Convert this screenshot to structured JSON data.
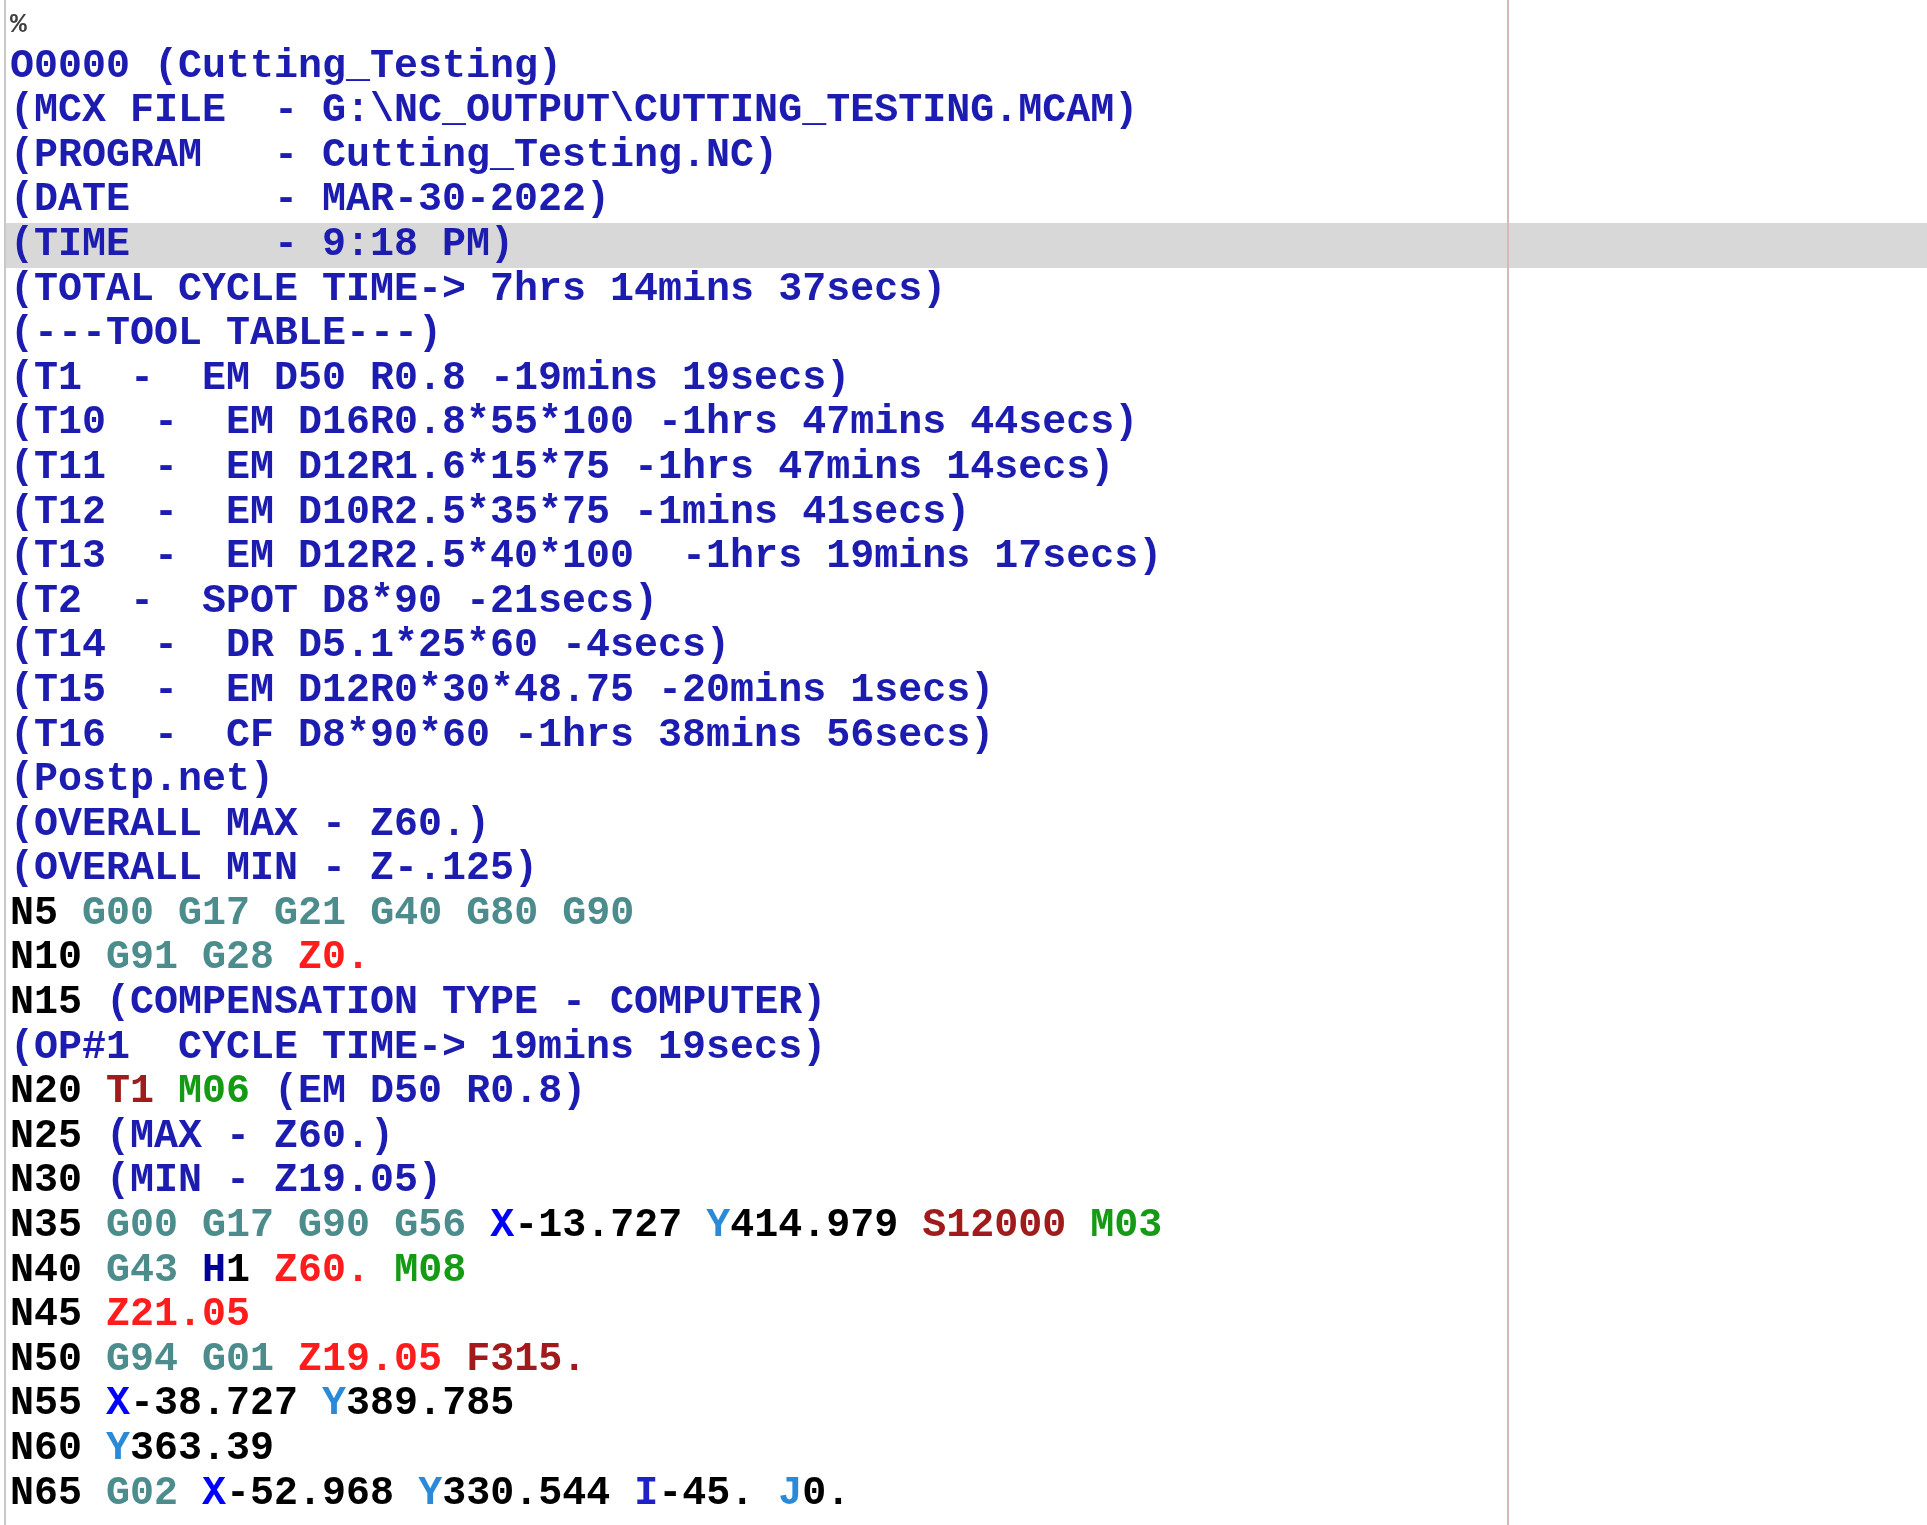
{
  "editor": {
    "lines": [
      {
        "selected": false,
        "tokens": [
          {
            "kind": "percent",
            "text": "%"
          }
        ]
      },
      {
        "selected": false,
        "tokens": [
          {
            "kind": "program",
            "text": "O0000"
          },
          {
            "kind": "comment",
            "text": "(Cutting_Testing)"
          }
        ]
      },
      {
        "selected": false,
        "tokens": [
          {
            "kind": "comment",
            "text": "(MCX FILE  - G:\\NC_OUTPUT\\CUTTING_TESTING.MCAM)"
          }
        ]
      },
      {
        "selected": false,
        "tokens": [
          {
            "kind": "comment",
            "text": "(PROGRAM   - Cutting_Testing.NC)"
          }
        ]
      },
      {
        "selected": false,
        "tokens": [
          {
            "kind": "comment",
            "text": "(DATE      - MAR-30-2022)"
          }
        ]
      },
      {
        "selected": true,
        "tokens": [
          {
            "kind": "comment",
            "text": "(TIME      - 9:18 PM)"
          }
        ]
      },
      {
        "selected": false,
        "tokens": [
          {
            "kind": "comment",
            "text": "(TOTAL CYCLE TIME-> 7hrs 14mins 37secs)"
          }
        ]
      },
      {
        "selected": false,
        "tokens": [
          {
            "kind": "comment",
            "text": "(---TOOL TABLE---)"
          }
        ]
      },
      {
        "selected": false,
        "tokens": [
          {
            "kind": "comment",
            "text": "(T1  -  EM D50 R0.8 -19mins 19secs)"
          }
        ]
      },
      {
        "selected": false,
        "tokens": [
          {
            "kind": "comment",
            "text": "(T10  -  EM D16R0.8*55*100 -1hrs 47mins 44secs)"
          }
        ]
      },
      {
        "selected": false,
        "tokens": [
          {
            "kind": "comment",
            "text": "(T11  -  EM D12R1.6*15*75 -1hrs 47mins 14secs)"
          }
        ]
      },
      {
        "selected": false,
        "tokens": [
          {
            "kind": "comment",
            "text": "(T12  -  EM D10R2.5*35*75 -1mins 41secs)"
          }
        ]
      },
      {
        "selected": false,
        "tokens": [
          {
            "kind": "comment",
            "text": "(T13  -  EM D12R2.5*40*100  -1hrs 19mins 17secs)"
          }
        ]
      },
      {
        "selected": false,
        "tokens": [
          {
            "kind": "comment",
            "text": "(T2  -  SPOT D8*90 -21secs)"
          }
        ]
      },
      {
        "selected": false,
        "tokens": [
          {
            "kind": "comment",
            "text": "(T14  -  DR D5.1*25*60 -4secs)"
          }
        ]
      },
      {
        "selected": false,
        "tokens": [
          {
            "kind": "comment",
            "text": "(T15  -  EM D12R0*30*48.75 -20mins 1secs)"
          }
        ]
      },
      {
        "selected": false,
        "tokens": [
          {
            "kind": "comment",
            "text": "(T16  -  CF D8*90*60 -1hrs 38mins 56secs)"
          }
        ]
      },
      {
        "selected": false,
        "tokens": [
          {
            "kind": "comment",
            "text": "(Postp.net)"
          }
        ]
      },
      {
        "selected": false,
        "tokens": [
          {
            "kind": "comment",
            "text": "(OVERALL MAX - Z60.)"
          }
        ]
      },
      {
        "selected": false,
        "tokens": [
          {
            "kind": "comment",
            "text": "(OVERALL MIN - Z-.125)"
          }
        ]
      },
      {
        "selected": false,
        "tokens": [
          {
            "kind": "n",
            "text": "N5"
          },
          {
            "kind": "g",
            "text": "G00"
          },
          {
            "kind": "g",
            "text": "G17"
          },
          {
            "kind": "g",
            "text": "G21"
          },
          {
            "kind": "g",
            "text": "G40"
          },
          {
            "kind": "g",
            "text": "G80"
          },
          {
            "kind": "g",
            "text": "G90"
          }
        ]
      },
      {
        "selected": false,
        "tokens": [
          {
            "kind": "n",
            "text": "N10"
          },
          {
            "kind": "g",
            "text": "G91"
          },
          {
            "kind": "g",
            "text": "G28"
          },
          {
            "kind": "z",
            "text": "Z0."
          }
        ]
      },
      {
        "selected": false,
        "tokens": [
          {
            "kind": "n",
            "text": "N15"
          },
          {
            "kind": "comment",
            "text": "(COMPENSATION TYPE - COMPUTER)"
          }
        ]
      },
      {
        "selected": false,
        "tokens": [
          {
            "kind": "comment",
            "text": "(OP#1  CYCLE TIME-> 19mins 19secs)"
          }
        ]
      },
      {
        "selected": false,
        "tokens": [
          {
            "kind": "n",
            "text": "N20"
          },
          {
            "kind": "t",
            "text": "T1"
          },
          {
            "kind": "m",
            "text": "M06"
          },
          {
            "kind": "comment",
            "text": "(EM D50 R0.8)"
          }
        ]
      },
      {
        "selected": false,
        "tokens": [
          {
            "kind": "n",
            "text": "N25"
          },
          {
            "kind": "comment",
            "text": "(MAX - Z60.)"
          }
        ]
      },
      {
        "selected": false,
        "tokens": [
          {
            "kind": "n",
            "text": "N30"
          },
          {
            "kind": "comment",
            "text": "(MIN - Z19.05)"
          }
        ]
      },
      {
        "selected": false,
        "tokens": [
          {
            "kind": "n",
            "text": "N35"
          },
          {
            "kind": "g",
            "text": "G00"
          },
          {
            "kind": "g",
            "text": "G17"
          },
          {
            "kind": "g",
            "text": "G90"
          },
          {
            "kind": "g",
            "text": "G56"
          },
          {
            "kind": "x",
            "text": "X-13.727"
          },
          {
            "kind": "y",
            "text": "Y414.979"
          },
          {
            "kind": "s",
            "text": "S12000"
          },
          {
            "kind": "m",
            "text": "M03"
          }
        ]
      },
      {
        "selected": false,
        "tokens": [
          {
            "kind": "n",
            "text": "N40"
          },
          {
            "kind": "g",
            "text": "G43"
          },
          {
            "kind": "h",
            "text": "H1"
          },
          {
            "kind": "z",
            "text": "Z60."
          },
          {
            "kind": "m",
            "text": "M08"
          }
        ]
      },
      {
        "selected": false,
        "tokens": [
          {
            "kind": "n",
            "text": "N45"
          },
          {
            "kind": "z",
            "text": "Z21.05"
          }
        ]
      },
      {
        "selected": false,
        "tokens": [
          {
            "kind": "n",
            "text": "N50"
          },
          {
            "kind": "g",
            "text": "G94"
          },
          {
            "kind": "g",
            "text": "G01"
          },
          {
            "kind": "z",
            "text": "Z19.05"
          },
          {
            "kind": "f",
            "text": "F315."
          }
        ]
      },
      {
        "selected": false,
        "tokens": [
          {
            "kind": "n",
            "text": "N55"
          },
          {
            "kind": "x",
            "text": "X-38.727"
          },
          {
            "kind": "y",
            "text": "Y389.785"
          }
        ]
      },
      {
        "selected": false,
        "tokens": [
          {
            "kind": "n",
            "text": "N60"
          },
          {
            "kind": "y",
            "text": "Y363.39"
          }
        ]
      },
      {
        "selected": false,
        "tokens": [
          {
            "kind": "n",
            "text": "N65"
          },
          {
            "kind": "g",
            "text": "G02"
          },
          {
            "kind": "x",
            "text": "X-52.968"
          },
          {
            "kind": "y",
            "text": "Y330.544"
          },
          {
            "kind": "i",
            "text": "I-45."
          },
          {
            "kind": "j",
            "text": "J0."
          }
        ]
      }
    ]
  }
}
